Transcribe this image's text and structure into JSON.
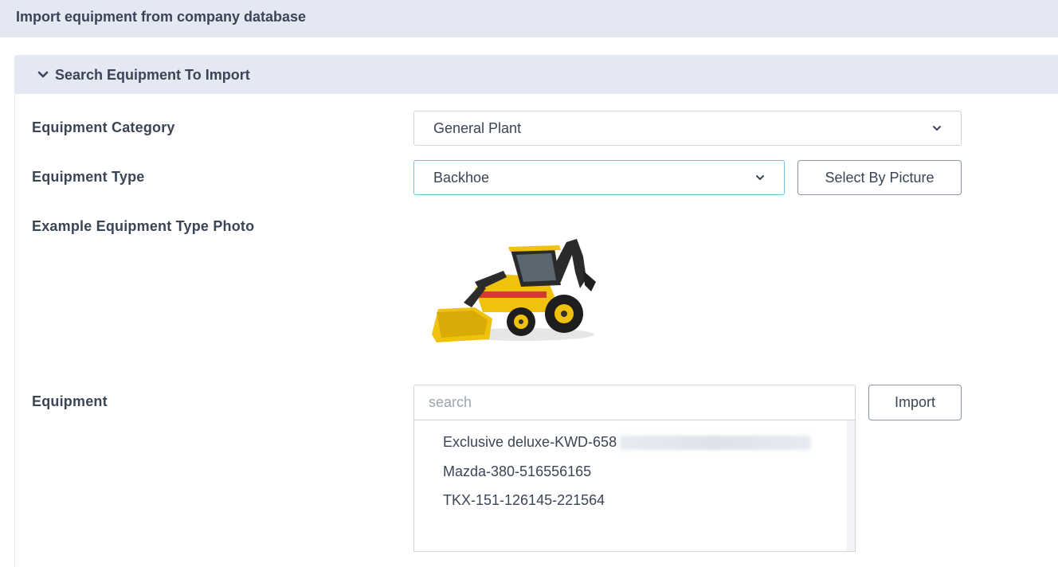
{
  "page": {
    "title": "Import equipment from company database"
  },
  "panel": {
    "title": "Search Equipment To Import"
  },
  "form": {
    "category": {
      "label": "Equipment Category",
      "value": "General Plant"
    },
    "type": {
      "label": "Equipment Type",
      "value": "Backhoe",
      "select_by_picture_label": "Select By Picture"
    },
    "photo": {
      "label": "Example Equipment Type Photo",
      "icon": "backhoe-image"
    },
    "equipment": {
      "label": "Equipment",
      "search_placeholder": "search",
      "import_label": "Import",
      "options": [
        "Exclusive deluxe-KWD-658",
        "Mazda-380-516556165",
        "TKX-151-126145-221564"
      ]
    }
  },
  "colors": {
    "header_bg": "#e3e8f2",
    "text": "#3a4556",
    "focus_border": "#6fc6d6",
    "machine_yellow": "#f0c20e"
  }
}
